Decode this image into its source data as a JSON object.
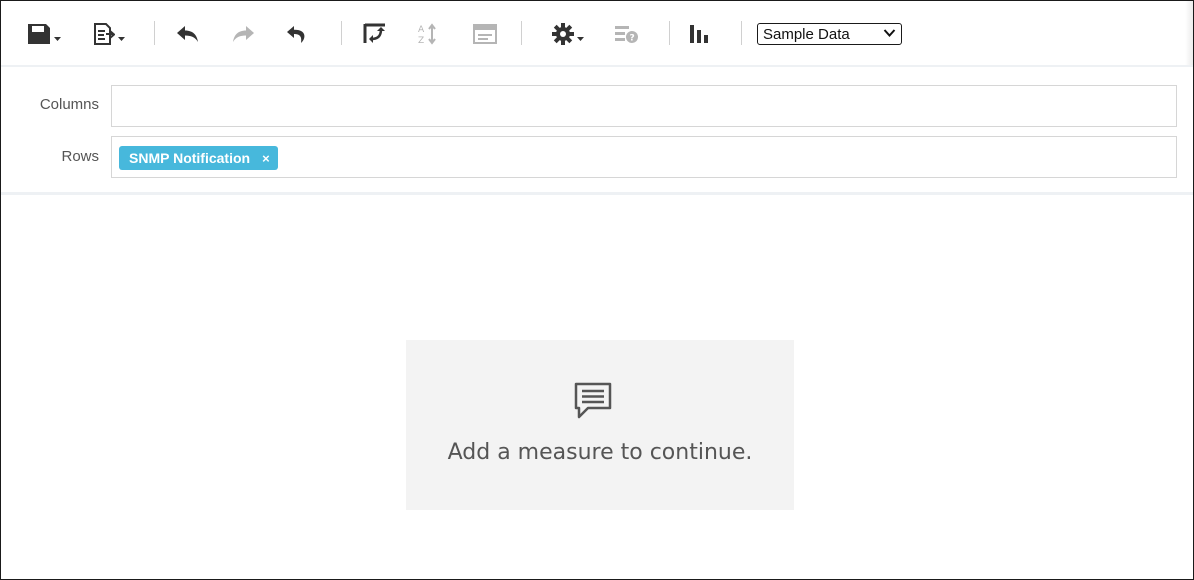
{
  "toolbar": {
    "items": [
      {
        "name": "save-icon",
        "enabled": true
      },
      {
        "name": "export-icon",
        "enabled": true
      },
      {
        "name": "undo-icon",
        "enabled": true
      },
      {
        "name": "redo-icon",
        "enabled": false
      },
      {
        "name": "reset-icon",
        "enabled": true
      },
      {
        "name": "swap-axes-icon",
        "enabled": true
      },
      {
        "name": "sort-icon",
        "enabled": false
      },
      {
        "name": "field-list-icon",
        "enabled": false
      },
      {
        "name": "settings-icon",
        "enabled": true
      },
      {
        "name": "calculated-field-icon",
        "enabled": false
      },
      {
        "name": "chart-icon",
        "enabled": true
      }
    ],
    "data_source": {
      "selected": "Sample Data"
    }
  },
  "zones": {
    "columns": {
      "label": "Columns",
      "fields": []
    },
    "rows": {
      "label": "Rows",
      "fields": [
        "SNMP Notification"
      ]
    }
  },
  "message": {
    "icon": "message-icon",
    "text": "Add a measure to continue."
  },
  "colors": {
    "chip": "#47b8dc",
    "icon": "#333333",
    "icon_disabled": "#b5b5b5",
    "message_bg": "#f3f3f3",
    "message_text": "#555555"
  }
}
